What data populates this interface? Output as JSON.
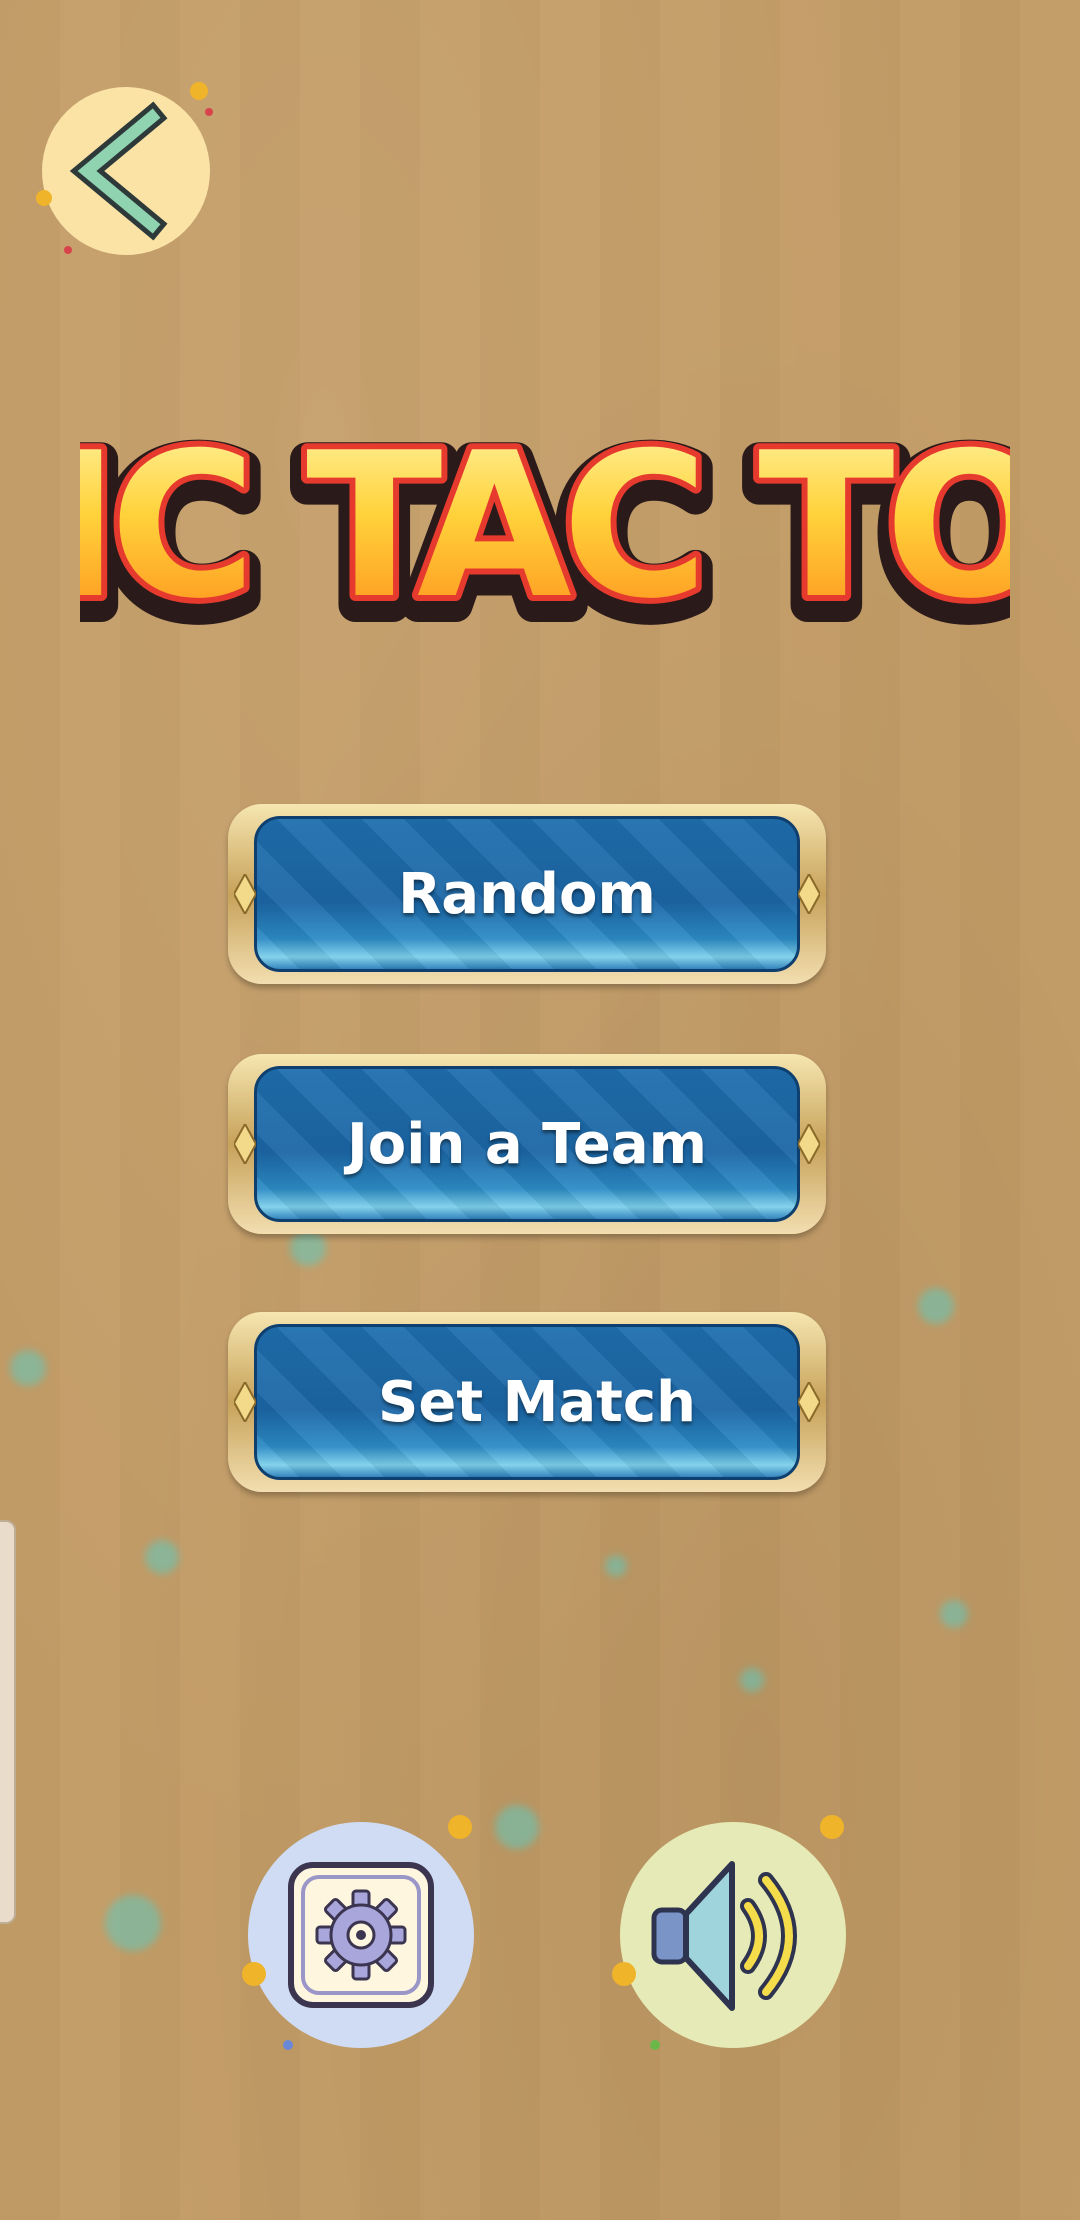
{
  "title": {
    "text": "TIC TAC TOE"
  },
  "menu": {
    "random_label": "Random",
    "join_team_label": "Join a Team",
    "set_match_label": "Set Match"
  },
  "icons": {
    "back": "chevron-left-icon",
    "settings": "gear-icon",
    "sound": "speaker-icon"
  },
  "colors": {
    "background": "#c39c66",
    "button_blue": "#1f6fae",
    "title_yellow": "#ffd23a",
    "title_red": "#e63a2e"
  }
}
